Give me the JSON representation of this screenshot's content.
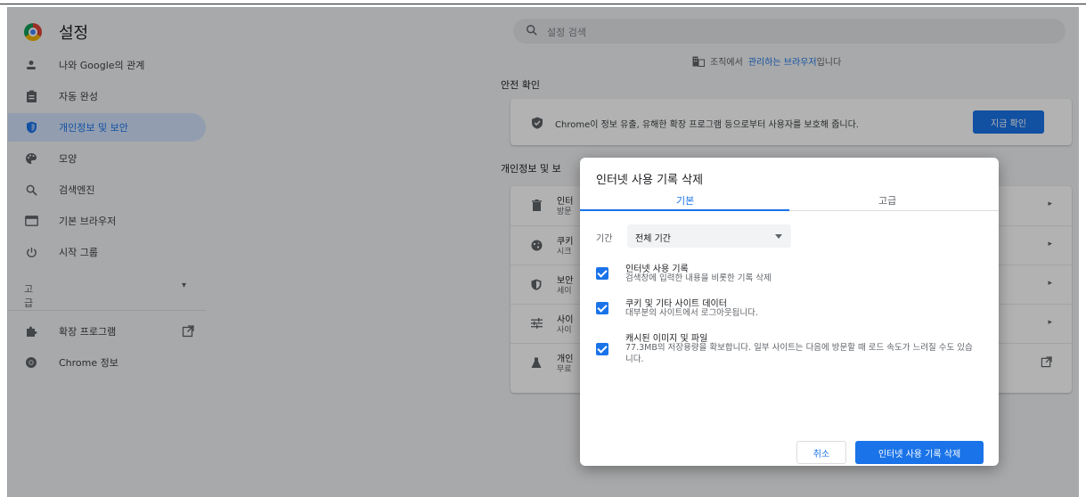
{
  "app": {
    "title": "설정"
  },
  "search": {
    "placeholder": "설정 검색"
  },
  "sidebar": {
    "items": [
      {
        "label": "나와 Google의 관계",
        "icon": "person-icon"
      },
      {
        "label": "자동 완성",
        "icon": "clipboard-icon"
      },
      {
        "label": "개인정보 및 보안",
        "icon": "shield-icon"
      },
      {
        "label": "모양",
        "icon": "palette-icon"
      },
      {
        "label": "검색엔진",
        "icon": "search-icon"
      },
      {
        "label": "기본 브라우저",
        "icon": "browser-icon"
      },
      {
        "label": "시작 그룹",
        "icon": "power-icon"
      }
    ],
    "advanced_label": "고급",
    "extensions_label": "확장 프로그램",
    "about_label": "Chrome 정보"
  },
  "main": {
    "managed_prefix": "조직에서",
    "managed_link": "관리하는 브라우저",
    "managed_suffix": "입니다",
    "safety_title": "안전 확인",
    "safety_text": "Chrome이 정보 유출, 유해한 확장 프로그램 등으로부터 사용자를 보호해 줍니다.",
    "safety_button": "지금 확인",
    "privacy_title": "개인정보 및 보",
    "rows": [
      {
        "title": "인터",
        "sub": "방문"
      },
      {
        "title": "쿠키",
        "sub": "시크"
      },
      {
        "title": "보안",
        "sub": "세이"
      },
      {
        "title": "사이",
        "sub": "사이"
      },
      {
        "title": "개인",
        "sub": "무료"
      }
    ]
  },
  "dialog": {
    "title": "인터넷 사용 기록 삭제",
    "tab_basic": "기본",
    "tab_advanced": "고급",
    "period_label": "기간",
    "period_value": "전체 기간",
    "options": [
      {
        "title": "인터넷 사용 기록",
        "sub": "검색창에 입력한 내용을 비롯한 기록 삭제",
        "checked": true
      },
      {
        "title": "쿠키 및 기타 사이트 데이터",
        "sub": "대부분의 사이트에서 로그아웃됩니다.",
        "checked": true
      },
      {
        "title": "캐시된 이미지 및 파일",
        "sub": "77.3MB의 저장용량을 확보합니다. 일부 사이트는 다음에 방문할 때 로드 속도가 느려질 수도 있습니다.",
        "checked": true
      }
    ],
    "cancel_label": "취소",
    "delete_label": "인터넷 사용 기록 삭제"
  },
  "colors": {
    "accent": "#1a73e8",
    "active_nav_bg": "#d2e3fc"
  }
}
